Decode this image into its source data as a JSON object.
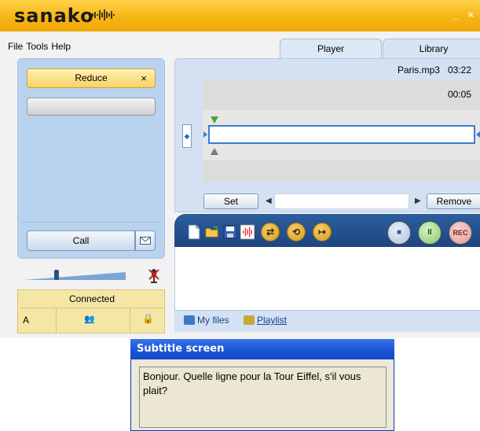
{
  "app": {
    "logo": "sanako",
    "window_controls": "_ ×"
  },
  "menu": {
    "items": [
      "File",
      "Tools",
      "Help"
    ]
  },
  "left_panel": {
    "reduce_label": "Reduce",
    "reduce_close": "×",
    "call_label": "Call",
    "status": "Connected",
    "channel": "A",
    "volume_level_fraction": 0.3
  },
  "tabs": [
    {
      "label": "Player",
      "active": true
    },
    {
      "label": "Library",
      "active": false
    }
  ],
  "player": {
    "file_name": "Paris.mp3",
    "duration": "03:22",
    "position": "00:05",
    "set_label": "Set",
    "remove_label": "Remove",
    "bookmark_value": ""
  },
  "toolbar": {
    "buttons": [
      "new-icon",
      "open-folder-icon",
      "save-icon",
      "waveform-icon",
      "shuffle-icon",
      "repeat-icon",
      "exit-icon"
    ],
    "stop_label": "■",
    "pause_label": "II",
    "record_label": "REC"
  },
  "bottom_tabs": {
    "files_label": "My files",
    "playlist_label": "Playlist"
  },
  "subtitle": {
    "title": "Subtitle screen",
    "text": "Bonjour. Quelle ligne pour la Tour Eiffel, s'il vous plait?"
  },
  "colors": {
    "brand_amber": "#f7b514",
    "panel_blue": "#b9d2ee",
    "toolbar_blue": "#1e4680",
    "xp_title_blue": "#1d56d8"
  }
}
